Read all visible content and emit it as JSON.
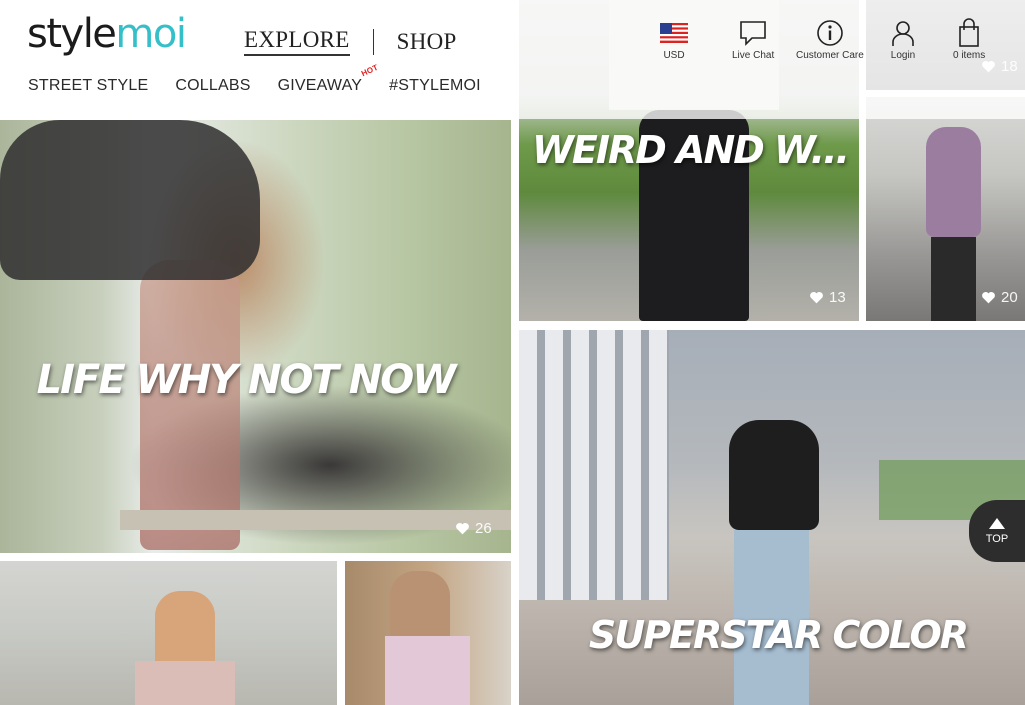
{
  "brand": {
    "part1": "style",
    "part2": "moi"
  },
  "main_nav": {
    "explore": "EXPLORE",
    "shop": "SHOP"
  },
  "sub_nav": [
    {
      "label": "STREET STYLE"
    },
    {
      "label": "COLLABS"
    },
    {
      "label": "GIVEAWAY",
      "badge": "HOT"
    },
    {
      "label": "#STYLEMOI"
    }
  ],
  "utility": {
    "currency": "USD",
    "live_chat": "Live Chat",
    "customer_care": "Customer Care",
    "login": "Login",
    "cart": "0 items"
  },
  "posts": [
    {
      "title": "LIFE WHY NOT NOW",
      "likes": "26"
    },
    {
      "title": "WEIRD AND W...",
      "likes": "13"
    },
    {
      "title": "",
      "likes": "20"
    },
    {
      "title": "SUPERSTAR COLOR",
      "likes": ""
    },
    {
      "title": "",
      "likes": "18"
    }
  ],
  "back_to_top": "TOP",
  "colors": {
    "brand_teal": "#35c0c9",
    "brand_dark": "#1b1b1b",
    "hot_badge": "#e02020"
  }
}
